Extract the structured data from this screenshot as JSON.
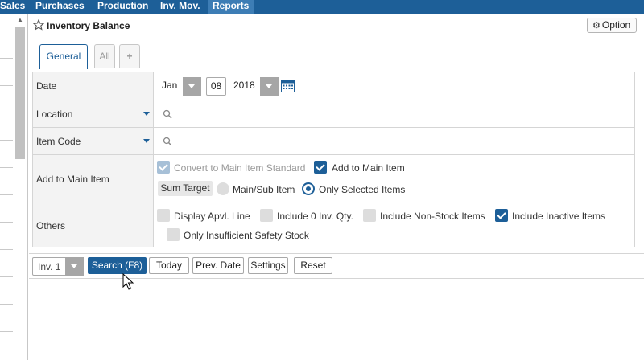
{
  "nav": {
    "items": [
      {
        "label": "Sales"
      },
      {
        "label": "Purchases"
      },
      {
        "label": "Production"
      },
      {
        "label": "Inv. Mov."
      },
      {
        "label": "Reports"
      }
    ]
  },
  "page": {
    "title": "Inventory Balance",
    "option_label": "Option"
  },
  "tabs": {
    "general": "General",
    "all": "All",
    "add": "+"
  },
  "form": {
    "date": {
      "label": "Date",
      "month": "Jan",
      "day": "08",
      "year": "2018"
    },
    "location": {
      "label": "Location"
    },
    "item_code": {
      "label": "Item Code"
    },
    "add_to_main": {
      "label": "Add to Main Item",
      "convert_label": "Convert to Main Item Standard",
      "add_label": "Add to Main Item",
      "sum_target": "Sum Target",
      "main_sub": "Main/Sub Item",
      "only_selected": "Only Selected Items"
    },
    "others": {
      "label": "Others",
      "display_apvl": "Display Apvl. Line",
      "include_zero": "Include 0 Inv. Qty.",
      "include_nonstock": "Include Non-Stock Items",
      "include_inactive": "Include Inactive Items",
      "only_insufficient": "Only Insufficient Safety Stock"
    }
  },
  "toolbar": {
    "inv_select": "Inv. 1",
    "search": "Search (F8)",
    "today": "Today",
    "prev_date": "Prev. Date",
    "settings": "Settings",
    "reset": "Reset"
  },
  "colors": {
    "brand": "#1d5f98",
    "nav_active": "#3d7db5"
  }
}
